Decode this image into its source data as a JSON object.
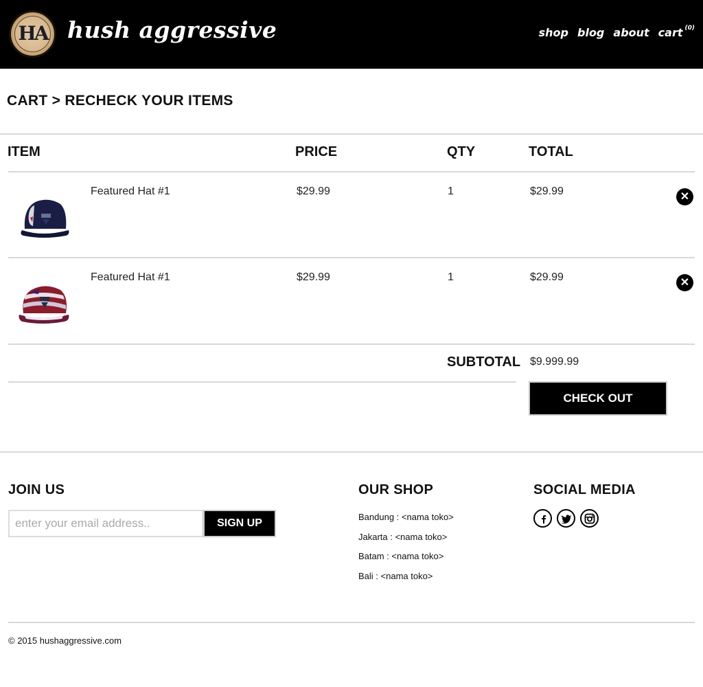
{
  "header": {
    "logo_monogram": "HA",
    "brand": "hush aggressive",
    "nav": [
      {
        "label": "shop"
      },
      {
        "label": "blog"
      },
      {
        "label": "about"
      },
      {
        "label": "cart",
        "count": "(0)"
      }
    ]
  },
  "page": {
    "title": "CART > RECHECK YOUR ITEMS"
  },
  "table": {
    "columns": {
      "item": "ITEM",
      "price": "PRICE",
      "qty": "QTY",
      "total": "TOTAL"
    },
    "rows": [
      {
        "name": "Featured Hat #1",
        "price": "$29.99",
        "qty": "1",
        "total": "$29.99",
        "image": "navy-five-panel-hat"
      },
      {
        "name": "Featured Hat #1",
        "price": "$29.99",
        "qty": "1",
        "total": "$29.99",
        "image": "red-pattern-five-panel-hat"
      }
    ],
    "remove_icon": "close-circle-icon"
  },
  "summary": {
    "subtotal_label": "SUBTOTAL",
    "subtotal_value": "$9.999.99",
    "checkout_label": "CHECK OUT"
  },
  "footer": {
    "join": {
      "heading": "JOIN US",
      "placeholder": "enter your email address..",
      "button": "SIGN UP"
    },
    "shop": {
      "heading": "OUR SHOP",
      "locations": [
        "Bandung : <nama toko>",
        "Jakarta : <nama toko>",
        "Batam : <nama toko>",
        "Bali : <nama toko>"
      ]
    },
    "social": {
      "heading": "SOCIAL MEDIA",
      "icons": [
        "facebook-icon",
        "twitter-icon",
        "instagram-icon"
      ]
    },
    "copyright": "© 2015 hushaggressive.com"
  },
  "colors": {
    "header_bg": "#000000",
    "button_bg": "#000000",
    "rule": "#d8d8d8"
  }
}
